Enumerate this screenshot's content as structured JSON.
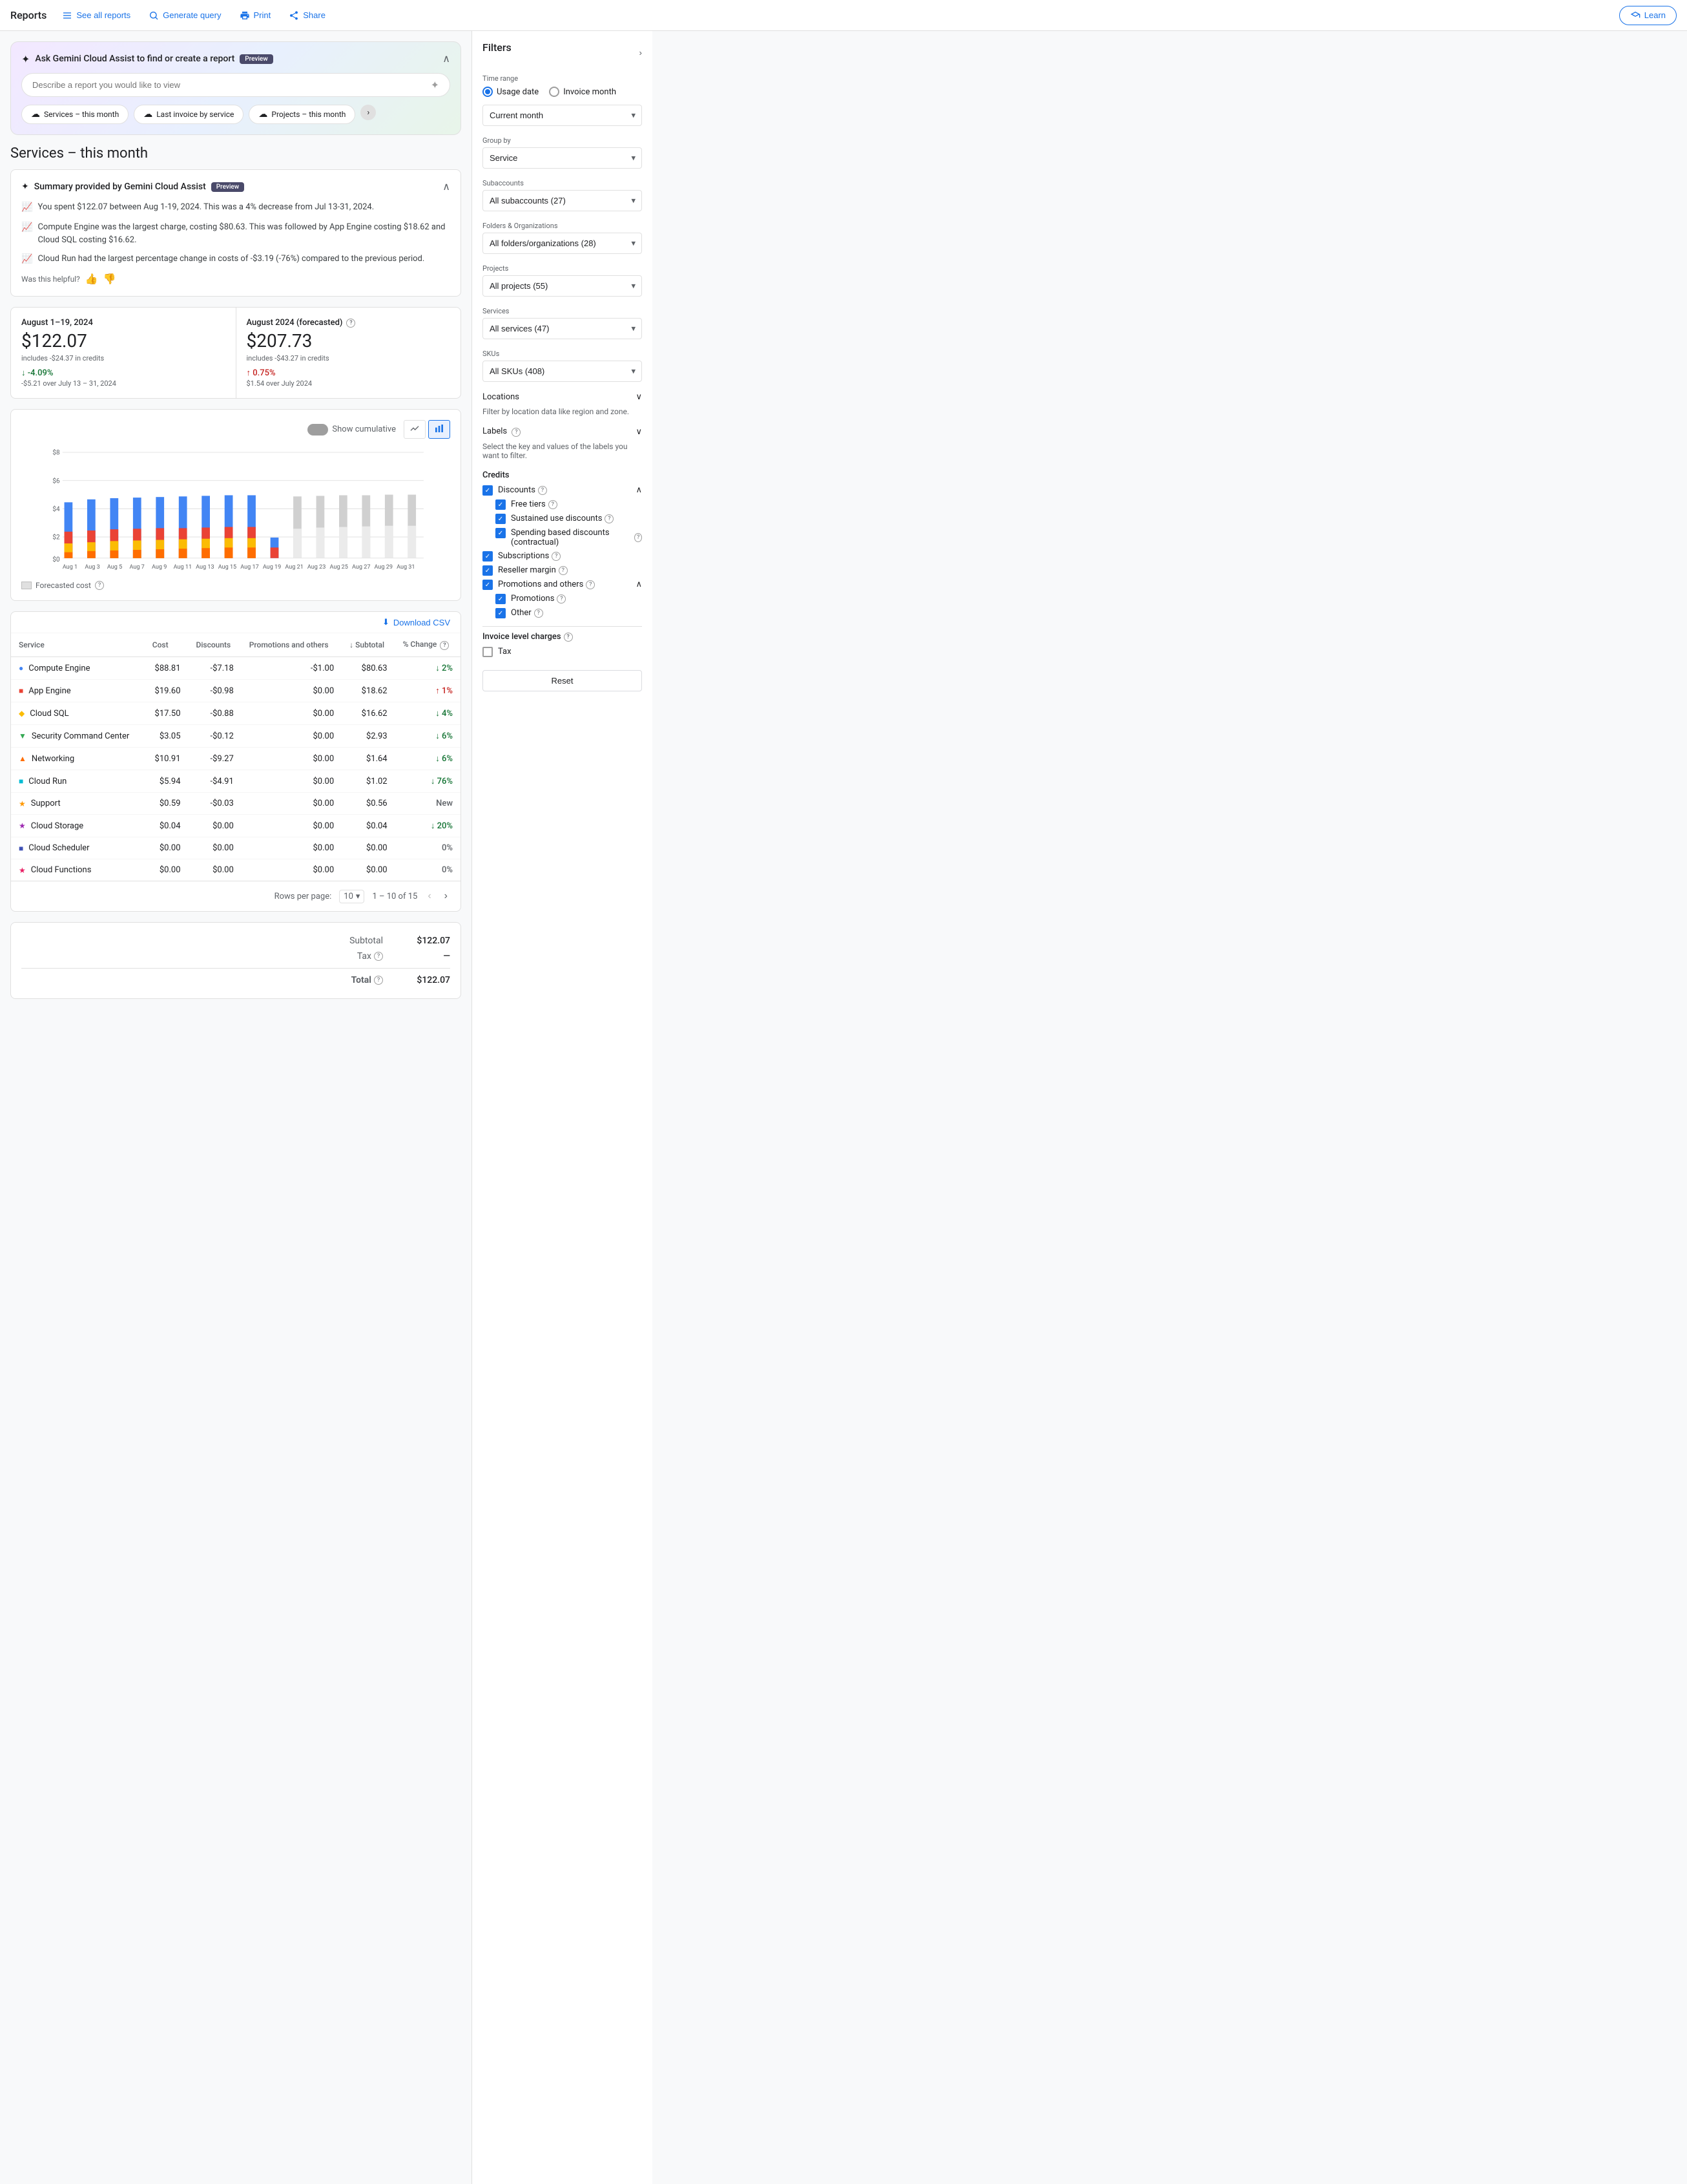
{
  "nav": {
    "title": "Reports",
    "see_all_reports": "See all reports",
    "generate_query": "Generate query",
    "print": "Print",
    "share": "Share",
    "learn": "Learn"
  },
  "gemini_bar": {
    "title": "Ask Gemini Cloud Assist to find or create a report",
    "preview_label": "Preview",
    "input_placeholder": "Describe a report you would like to view",
    "chips": [
      {
        "label": "Services – this month",
        "icon": "☁"
      },
      {
        "label": "Last invoice by service",
        "icon": "☁"
      },
      {
        "label": "Projects – this month",
        "icon": "☁"
      }
    ]
  },
  "section_title": "Services – this month",
  "summary": {
    "title": "Summary provided by Gemini Cloud Assist",
    "preview_label": "Preview",
    "items": [
      "You spent $122.07 between Aug 1-19, 2024. This was a 4% decrease from Jul 13-31, 2024.",
      "Compute Engine was the largest charge, costing $80.63. This was followed by App Engine costing $18.62 and Cloud SQL costing $16.62.",
      "Cloud Run had the largest percentage change in costs of -$3.19 (-76%) compared to the previous period."
    ],
    "feedback_label": "Was this helpful?"
  },
  "cost_cards": {
    "current": {
      "period": "August 1–19, 2024",
      "amount": "$122.07",
      "note": "includes -$24.37 in credits",
      "change": "-4.09%",
      "change_note": "-$5.21 over July 13 – 31, 2024",
      "change_type": "green"
    },
    "forecasted": {
      "period": "August 2024 (forecasted)",
      "amount": "$207.73",
      "note": "includes -$43.27 in credits",
      "change": "0.75%",
      "change_note": "$1.54 over July 2024",
      "change_type": "red"
    }
  },
  "chart": {
    "show_cumulative": "Show cumulative",
    "y_labels": [
      "$8",
      "$6",
      "$4",
      "$2",
      "$0"
    ],
    "x_labels": [
      "Aug 1",
      "Aug 3",
      "Aug 5",
      "Aug 7",
      "Aug 9",
      "Aug 11",
      "Aug 13",
      "Aug 15",
      "Aug 17",
      "Aug 19",
      "Aug 21",
      "Aug 23",
      "Aug 25",
      "Aug 27",
      "Aug 29",
      "Aug 31"
    ],
    "forecasted_legend": "Forecasted cost"
  },
  "table": {
    "download_label": "Download CSV",
    "columns": [
      "Service",
      "Cost",
      "Discounts",
      "Promotions and others",
      "Subtotal",
      "% Change"
    ],
    "rows": [
      {
        "service": "Compute Engine",
        "color": "#4285f4",
        "cost": "$88.81",
        "discounts": "-$7.18",
        "promotions": "-$1.00",
        "subtotal": "$80.63",
        "change": "2%",
        "change_type": "green"
      },
      {
        "service": "App Engine",
        "color": "#ea4335",
        "cost": "$19.60",
        "discounts": "-$0.98",
        "promotions": "$0.00",
        "subtotal": "$18.62",
        "change": "1%",
        "change_type": "red"
      },
      {
        "service": "Cloud SQL",
        "color": "#fbbc04",
        "cost": "$17.50",
        "discounts": "-$0.88",
        "promotions": "$0.00",
        "subtotal": "$16.62",
        "change": "4%",
        "change_type": "green"
      },
      {
        "service": "Security Command Center",
        "color": "#34a853",
        "cost": "$3.05",
        "discounts": "-$0.12",
        "promotions": "$0.00",
        "subtotal": "$2.93",
        "change": "6%",
        "change_type": "green"
      },
      {
        "service": "Networking",
        "color": "#ff6d00",
        "cost": "$10.91",
        "discounts": "-$9.27",
        "promotions": "$0.00",
        "subtotal": "$1.64",
        "change": "6%",
        "change_type": "green"
      },
      {
        "service": "Cloud Run",
        "color": "#00bcd4",
        "cost": "$5.94",
        "discounts": "-$4.91",
        "promotions": "$0.00",
        "subtotal": "$1.02",
        "change": "76%",
        "change_type": "green"
      },
      {
        "service": "Support",
        "color": "#ff9800",
        "cost": "$0.59",
        "discounts": "-$0.03",
        "promotions": "$0.00",
        "subtotal": "$0.56",
        "change": "New",
        "change_type": "neutral"
      },
      {
        "service": "Cloud Storage",
        "color": "#9c27b0",
        "cost": "$0.04",
        "discounts": "$0.00",
        "promotions": "$0.00",
        "subtotal": "$0.04",
        "change": "20%",
        "change_type": "green"
      },
      {
        "service": "Cloud Scheduler",
        "color": "#3f51b5",
        "cost": "$0.00",
        "discounts": "$0.00",
        "promotions": "$0.00",
        "subtotal": "$0.00",
        "change": "0%",
        "change_type": "neutral"
      },
      {
        "service": "Cloud Functions",
        "color": "#e91e63",
        "cost": "$0.00",
        "discounts": "$0.00",
        "promotions": "$0.00",
        "subtotal": "$0.00",
        "change": "0%",
        "change_type": "neutral"
      }
    ],
    "pagination": {
      "rows_per_page": "Rows per page:",
      "rows_count": "10",
      "range": "1 – 10 of 15"
    }
  },
  "totals": {
    "subtotal_label": "Subtotal",
    "subtotal_value": "$122.07",
    "tax_label": "Tax",
    "tax_value": "—",
    "total_label": "Total",
    "total_value": "$122.07"
  },
  "filters": {
    "title": "Filters",
    "time_range_label": "Time range",
    "usage_date": "Usage date",
    "invoice_month": "Invoice month",
    "current_month": "Current month",
    "group_by_label": "Group by",
    "group_by_value": "Service",
    "subaccounts_label": "Subaccounts",
    "subaccounts_value": "All subaccounts (27)",
    "folders_label": "Folders & Organizations",
    "folders_value": "All folders/organizations (28)",
    "projects_label": "Projects",
    "projects_value": "All projects (55)",
    "services_label": "Services",
    "services_value": "All services (47)",
    "skus_label": "SKUs",
    "skus_value": "All SKUs (408)",
    "locations_label": "Locations",
    "locations_desc": "Filter by location data like region and zone.",
    "labels_label": "Labels",
    "labels_desc": "Select the key and values of the labels you want to filter.",
    "credits_title": "Credits",
    "discounts_label": "Discounts",
    "free_tiers_label": "Free tiers",
    "sustained_use_label": "Sustained use discounts",
    "spending_based_label": "Spending based discounts (contractual)",
    "subscriptions_label": "Subscriptions",
    "reseller_label": "Reseller margin",
    "promotions_label": "Promotions and others",
    "promotions_sub_label": "Promotions",
    "other_label": "Other",
    "invoice_charges_label": "Invoice level charges",
    "tax_label": "Tax",
    "reset_label": "Reset"
  }
}
